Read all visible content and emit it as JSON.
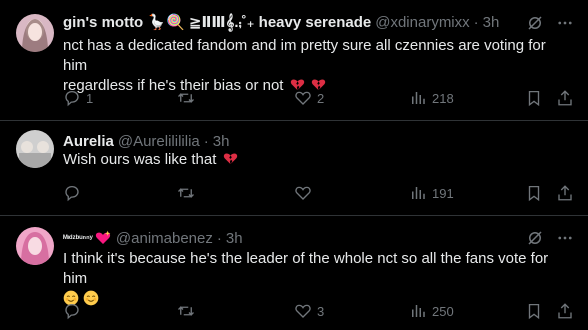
{
  "tweets": [
    {
      "display_name": "gin's motto 🪿🍭 ≧ⅡⅢ𝄞.⨾˚₊ heavy serenade",
      "handle": "@xdinarymixx",
      "time": "3h",
      "text_line1": "nct has a dedicated fandom and im pretty sure all czennies are voting for him",
      "text_line2": "regardless if he's their bias or not",
      "replies": "1",
      "retweets": "",
      "likes": "2",
      "views": "218",
      "avatar_color": "#d9b8c4"
    },
    {
      "display_name": "Aurelia",
      "handle": "@Aurelilililia",
      "time": "3h",
      "text_line1": "Wish ours was like that",
      "replies": "",
      "retweets": "",
      "likes": "",
      "views": "191",
      "avatar_color": "#c9c9c9"
    },
    {
      "display_name": "ᴹᶦᵈᶻᵇᵘⁿⁿʸ",
      "handle": "@animabenez",
      "time": "3h",
      "text_line1": "I think it's because he's the leader of the whole nct so all the fans vote for him",
      "replies": "",
      "retweets": "",
      "likes": "3",
      "views": "250",
      "avatar_color": "#f0a6c8"
    }
  ],
  "colors": {
    "background": "#000000",
    "text": "#e7e9ea",
    "muted": "#71767b",
    "divider": "#2f3336"
  },
  "icons": [
    "reply-icon",
    "retweet-icon",
    "like-icon",
    "views-icon",
    "bookmark-icon",
    "share-icon",
    "grok-icon",
    "more-icon"
  ]
}
